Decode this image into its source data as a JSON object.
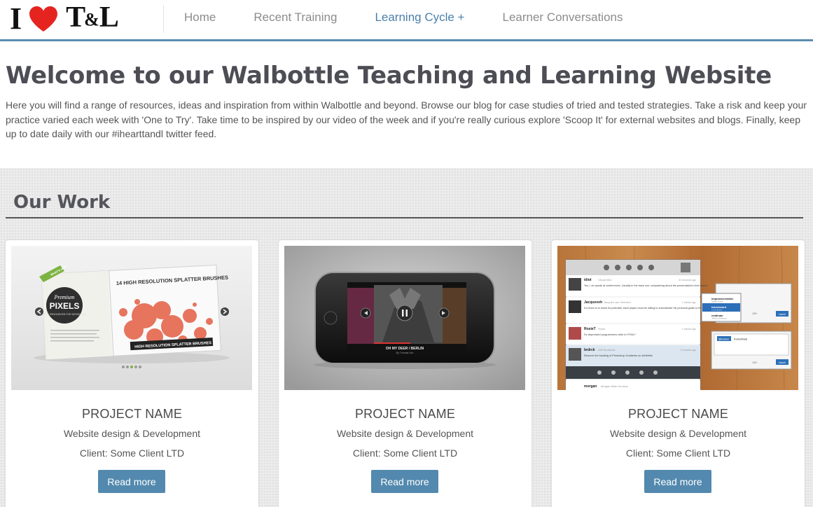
{
  "logo": {
    "i": "I",
    "tl_t": "T",
    "tl_amp": "&",
    "tl_l": "L",
    "heart_color": "#e52420"
  },
  "nav": {
    "items": [
      {
        "label": "Home",
        "active": false
      },
      {
        "label": "Recent Training",
        "active": false
      },
      {
        "label": "Learning Cycle +",
        "active": true
      },
      {
        "label": "Learner Conversations",
        "active": false
      }
    ]
  },
  "intro": {
    "title": "Welcome to our Walbottle Teaching and Learning Website",
    "body": "Here you will find a range of resources, ideas and inspiration from within Walbottle and beyond. Browse our blog for case studies of tried and tested strategies. Take a risk and keep your practice varied each week with 'One to Try'. Take time to be inspired by our video of the week and if you're really curious explore 'Scoop It' for external websites and blogs. Finally, keep up to date daily with our #ihearttandl twitter feed."
  },
  "work": {
    "heading": "Our Work",
    "projects": [
      {
        "name": "PROJECT NAME",
        "desc": "Website design & Development",
        "client": "Client: Some Client LTD",
        "button": "Read more",
        "thumb": {
          "title": "14 HIGH RESOLUTION SPLATTER BRUSHES",
          "badge_top": "Premium",
          "badge_main": "PIXELS",
          "badge_sub": "FREE RESOURCES FOR DESIGNERS",
          "ribbon": "WHAT'S HOT!",
          "footer": "HIGH RESOLUTION SPLATTER BRUSHES"
        }
      },
      {
        "name": "PROJECT NAME",
        "desc": "Website design & Development",
        "client": "Client: Some Client LTD",
        "button": "Read more",
        "thumb": {
          "track": "OH MY DEER / BERLIN",
          "artist": "By Thomas Kint"
        }
      },
      {
        "name": "PROJECT NAME",
        "desc": "Website design & Development",
        "client": "Client: Some Client LTD",
        "button": "Read more",
        "thumb": {
          "tweets": [
            {
              "user": "idiot",
              "handle": "Visual Idiot",
              "text": "Yes, I do speak at conferences. Usually in the back row, complaining about the presentation's font choice.",
              "time": "42 seconds ago"
            },
            {
              "user": "Jacquevoh",
              "handle": "Jacques van Heerden",
              "text": "If a team is to reach its potential, each player must be willing to subordinate his personal goals to the good of the team.",
              "time": "1 minute ago"
            },
            {
              "user": "RosieT",
              "handle": "Rosie",
              "text": "Do depressed programmers write in HTML?",
              "time": "1 minute ago"
            },
            {
              "user": "brdrck",
              "handle": "Jeff Broderick",
              "text": "Remove the banding of Photoshop Gradients on #dribbble",
              "time": "5 minutes ago"
            },
            {
              "user": "morgan",
              "handle": "Morgan Allan Knutson",
              "text": "",
              "time": ""
            }
          ],
          "popup_items": [
            "impulsivcreative",
            "lukesbeard",
            "eoldman"
          ],
          "popup_names": [
            "Sarah Smith",
            "Luke Beard",
            "Jeffrey Zeldman"
          ],
          "popup2_tag": "@lcobar",
          "popup2_name": "Konichiwa!",
          "count": "130",
          "tweet_btn": "tweet"
        }
      }
    ]
  },
  "colors": {
    "accent": "#5389ae",
    "nav_active": "#4a7faa",
    "header_rule": "#5b8db0"
  }
}
